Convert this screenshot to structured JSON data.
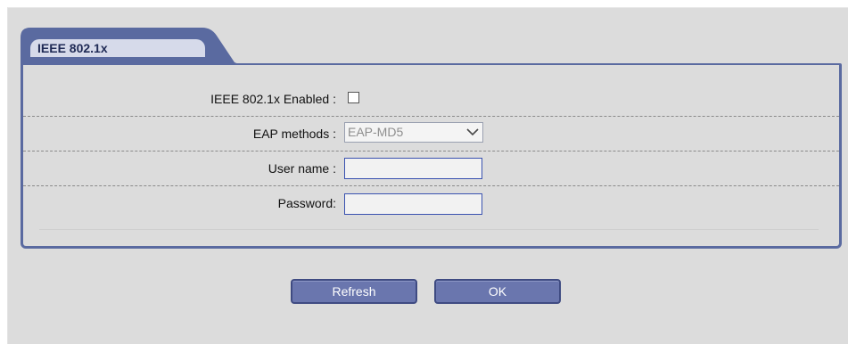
{
  "tab": {
    "label": "IEEE 802.1x"
  },
  "form": {
    "enabled_label": "IEEE 802.1x Enabled :",
    "enabled_checked": false,
    "eap_label": "EAP methods :",
    "eap_selected": "EAP-MD5",
    "username_label": "User name :",
    "username_value": "",
    "password_label": "Password:",
    "password_value": ""
  },
  "buttons": {
    "refresh_label": "Refresh",
    "ok_label": "OK"
  },
  "colors": {
    "accent": "#5a6aa0",
    "button_fill": "#6a76ae",
    "tab_fill": "#d6daea",
    "input_border": "#3a52b0"
  },
  "icons": {
    "select_arrow": "chevron-down-icon"
  }
}
